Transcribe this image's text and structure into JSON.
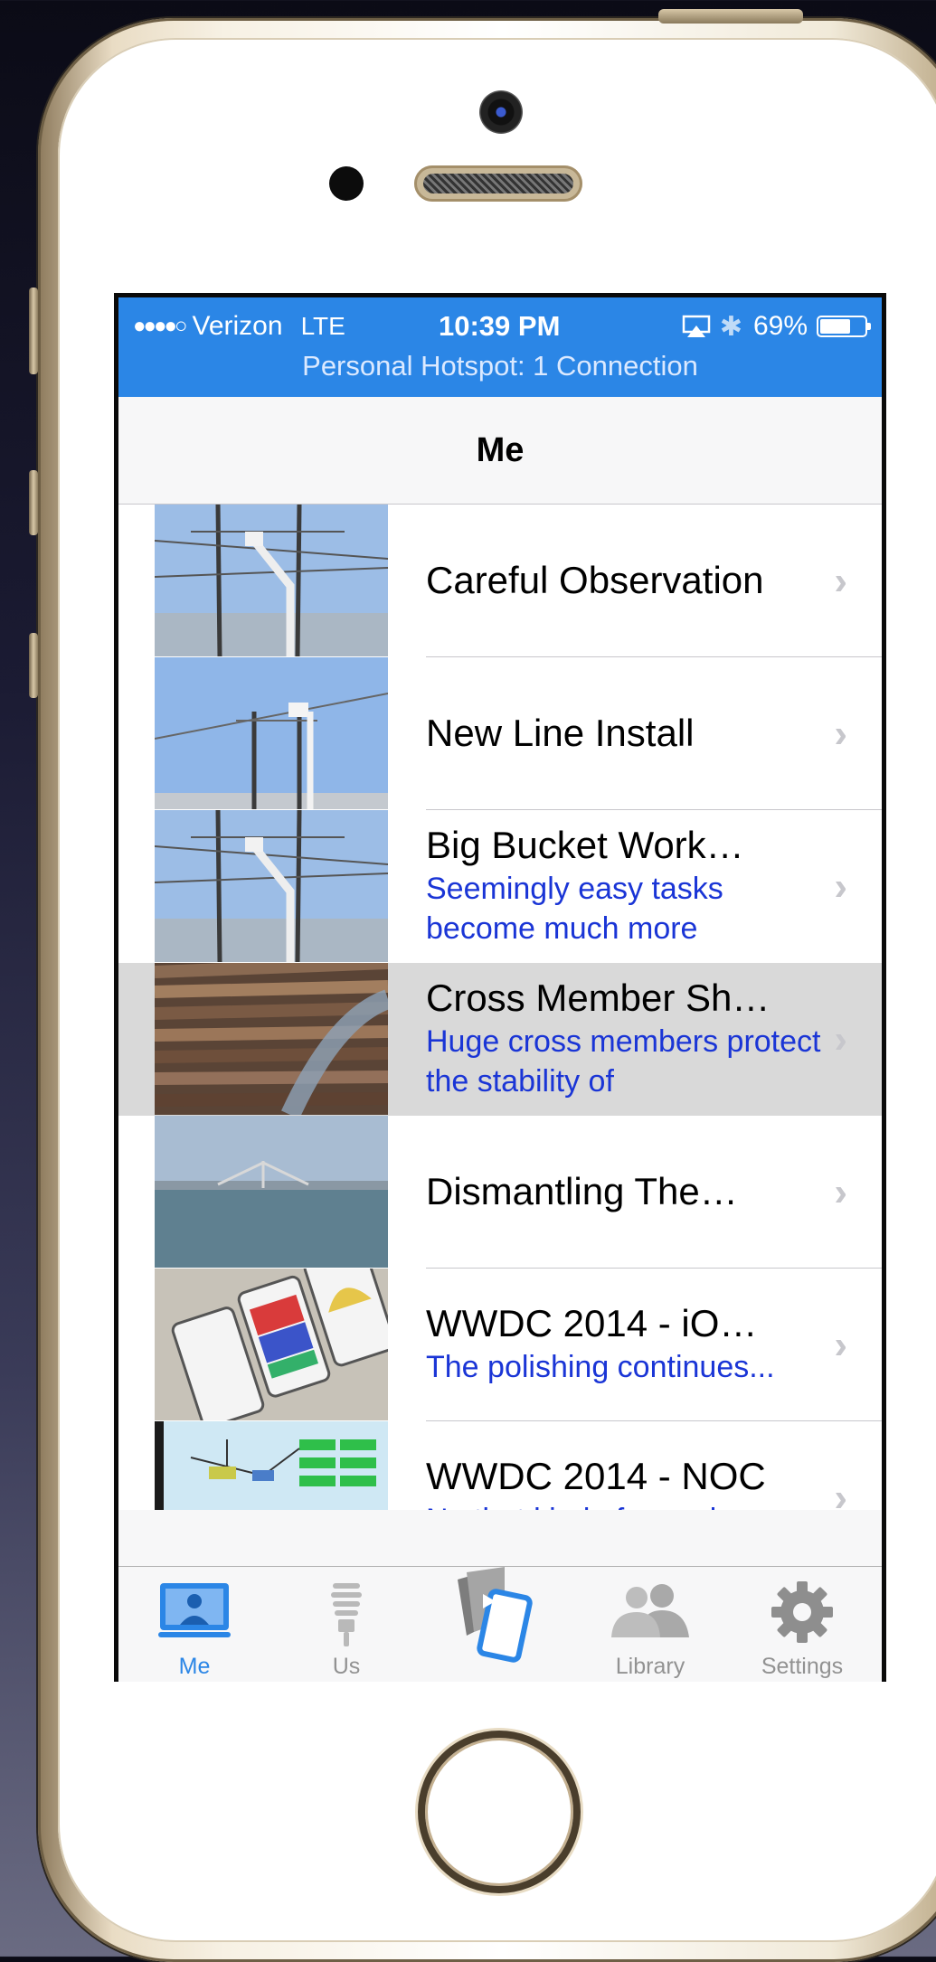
{
  "status_bar": {
    "signal_dots": "●●●●○",
    "carrier": "Verizon",
    "network": "LTE",
    "time": "10:39 PM",
    "battery_percent": "69%",
    "battery_level": 0.69,
    "hotspot": "Personal Hotspot: 1 Connection"
  },
  "nav": {
    "title": "Me"
  },
  "list": {
    "items": [
      {
        "title": "Careful Observation",
        "subtitle": "",
        "thumb": "sky-pole-bucket"
      },
      {
        "title": "New Line Install",
        "subtitle": "",
        "thumb": "sky-pole"
      },
      {
        "title": "Big Bucket Work…",
        "subtitle": "Seemingly easy tasks become much more",
        "thumb": "sky-pole-bucket"
      },
      {
        "title": "Cross Member Sh…",
        "subtitle": "Huge cross members protect the stability of",
        "thumb": "stacked-poles"
      },
      {
        "title": "Dismantling The…",
        "subtitle": "",
        "thumb": "bay-bridge"
      },
      {
        "title": "WWDC 2014 - iO…",
        "subtitle": "The polishing continues...",
        "thumb": "ios-slides"
      },
      {
        "title": "WWDC 2014 - NOC",
        "subtitle": "No that kind of speed",
        "thumb": "network-diagram"
      }
    ],
    "selected_index": 3
  },
  "tabbar": {
    "tabs": [
      {
        "label": "Me",
        "icon": "person-screen-icon",
        "active": true
      },
      {
        "label": "Us",
        "icon": "lightbulb-icon",
        "active": false
      },
      {
        "label": "",
        "icon": "media-tablet-icon",
        "active": false
      },
      {
        "label": "Library",
        "icon": "people-icon",
        "active": false
      },
      {
        "label": "Settings",
        "icon": "gear-icon",
        "active": false
      }
    ]
  },
  "colors": {
    "accent": "#2b86e6",
    "subtitle": "#1a35d6",
    "selected_row": "#d9d9d9"
  }
}
